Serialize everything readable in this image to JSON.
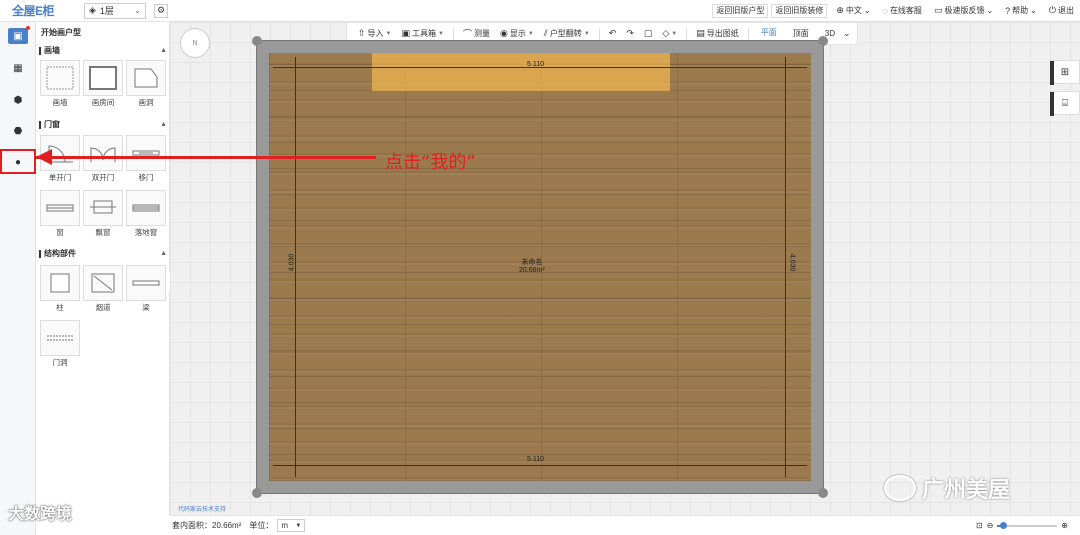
{
  "app": {
    "logo": "全屋E柜"
  },
  "top": {
    "floor": "1层",
    "buttons": [
      "返回旧版户型",
      "返回旧版装修"
    ],
    "links": [
      {
        "icon": "globe-icon",
        "glyph": "⊕",
        "label": "中文",
        "chevron": true
      },
      {
        "icon": "headset-icon",
        "glyph": "◌",
        "label": "在线客服",
        "chevron": false
      },
      {
        "icon": "feedback-icon",
        "glyph": "▭",
        "label": "极速版反馈",
        "chevron": true
      },
      {
        "icon": "help-icon",
        "glyph": "?",
        "label": "帮助",
        "chevron": true
      },
      {
        "icon": "power-icon",
        "glyph": "⏻",
        "label": "退出",
        "chevron": false
      }
    ]
  },
  "panel": {
    "title": "开始画户型",
    "sections": [
      {
        "title": "画墙",
        "items": [
          "画墙",
          "画房间",
          "画洞"
        ]
      },
      {
        "title": "门窗",
        "items": [
          "单开门",
          "双开门",
          "移门",
          "窗",
          "飘窗",
          "落地窗"
        ]
      },
      {
        "title": "结构部件",
        "items": [
          "柱",
          "烟道",
          "梁",
          "门洞"
        ]
      }
    ]
  },
  "toolbar": {
    "tools": [
      {
        "icon": "import-icon",
        "glyph": "⇧",
        "label": "导入",
        "chevron": true
      },
      {
        "icon": "toolbox-icon",
        "glyph": "▣",
        "label": "工具箱",
        "chevron": true
      },
      {
        "icon": "measure-icon",
        "glyph": "⌒",
        "label": "测量",
        "chevron": false
      },
      {
        "icon": "eye-icon",
        "glyph": "◉",
        "label": "显示",
        "chevron": true
      },
      {
        "icon": "flip-icon",
        "glyph": "⫽",
        "label": "户型翻转",
        "chevron": true
      },
      {
        "icon": "undo-icon",
        "glyph": "↶",
        "label": "",
        "chevron": false
      },
      {
        "icon": "redo-icon",
        "glyph": "↷",
        "label": "",
        "chevron": false
      },
      {
        "icon": "save-icon",
        "glyph": "▢",
        "label": "",
        "chevron": false
      },
      {
        "icon": "eraser-icon",
        "glyph": "◇",
        "label": "",
        "chevron": true
      },
      {
        "icon": "map-icon",
        "glyph": "▤",
        "label": "导出图纸",
        "chevron": false
      }
    ],
    "views": [
      "平面",
      "顶面",
      "3D"
    ],
    "active_view": "平面"
  },
  "room": {
    "top_dim": "5.110",
    "bottom_dim": "5.110",
    "left_dim": "4.030",
    "right_dim": "4.030",
    "name": "未命名",
    "area": "20.66m²"
  },
  "annotation": {
    "text": "点击“我的”"
  },
  "status": {
    "area_label": "套内面积：20.66m²",
    "unit_label": "单位：",
    "unit": "m"
  },
  "zoom": {
    "level": 0.1
  },
  "compass": {
    "label": "N"
  },
  "watermarks": {
    "left": "大数跨境",
    "right": "广州美屋",
    "small": "代码家云技术支持"
  }
}
